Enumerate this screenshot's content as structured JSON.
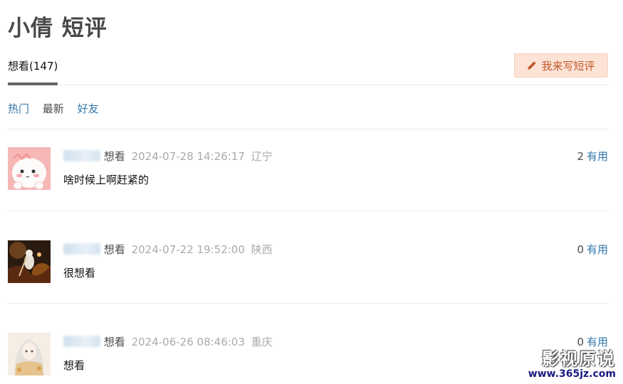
{
  "page": {
    "title": "小倩 短评"
  },
  "tabs": [
    {
      "label": "想看(147)"
    }
  ],
  "write_button": {
    "label": "我来写短评",
    "icon": "pencil-icon"
  },
  "sorts": [
    {
      "label": "热门",
      "style": "link"
    },
    {
      "label": "最新",
      "style": "plain"
    },
    {
      "label": "好友",
      "style": "link"
    }
  ],
  "comments": [
    {
      "status": "想看",
      "time": "2024-07-28 14:26:17",
      "location": "辽宁",
      "votes": "2",
      "useful_label": "有用",
      "content": "啥时候上啊赶紧的"
    },
    {
      "status": "想看",
      "time": "2024-07-22 19:52:00",
      "location": "陕西",
      "votes": "0",
      "useful_label": "有用",
      "content": "很想看"
    },
    {
      "status": "想看",
      "time": "2024-06-26 08:46:03",
      "location": "重庆",
      "votes": "0",
      "useful_label": "有用",
      "content": "想看"
    }
  ],
  "watermark": {
    "name": "影视原说",
    "url": "www.365jz.com"
  },
  "colors": {
    "link": "#3377aa",
    "button_bg": "#fce3d6",
    "button_text": "#c1592d",
    "muted": "#aaaaaa"
  }
}
